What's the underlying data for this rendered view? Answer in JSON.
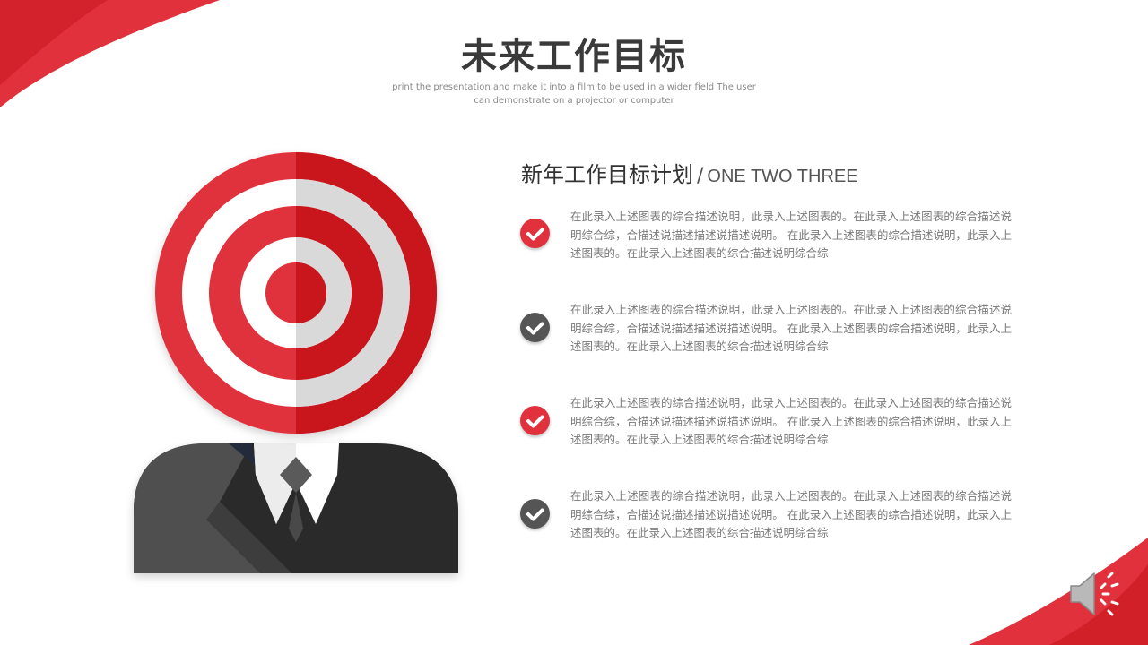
{
  "title": "未来工作目标",
  "subtitle": "print the presentation and make it into a film to be used in a wider field The user can demonstrate on a projector or computer",
  "section": {
    "heading_cn": "新年工作目标计划",
    "separator": "/",
    "heading_en": "ONE TWO THREE"
  },
  "items": [
    {
      "check_color": "#e0313d",
      "icon": "check-icon",
      "text": "在此录入上述图表的综合描述说明，此录入上述图表的。在此录入上述图表的综合描述说明综合综，合描述说描述描述说描述说明。 在此录入上述图表的综合描述说明，此录入上述图表的。在此录入上述图表的综合描述说明综合综"
    },
    {
      "check_color": "#555555",
      "icon": "check-icon",
      "text": "在此录入上述图表的综合描述说明，此录入上述图表的。在此录入上述图表的综合描述说明综合综，合描述说描述描述说描述说明。 在此录入上述图表的综合描述说明，此录入上述图表的。在此录入上述图表的综合描述说明综合综"
    },
    {
      "check_color": "#e0313d",
      "icon": "check-icon",
      "text": "在此录入上述图表的综合描述说明，此录入上述图表的。在此录入上述图表的综合描述说明综合综，合描述说描述描述说描述说明。 在此录入上述图表的综合描述说明，此录入上述图表的。在此录入上述图表的综合描述说明综合综"
    },
    {
      "check_color": "#555555",
      "icon": "check-icon",
      "text": "在此录入上述图表的综合描述说明，此录入上述图表的。在此录入上述图表的综合描述说明综合综，合描述说描述描述说描述说明。 在此录入上述图表的综合描述说明，此录入上述图表的。在此录入上述图表的综合描述说明综合综"
    }
  ],
  "colors": {
    "accent": "#e0313d",
    "dark_red": "#c8161d",
    "gray_dark": "#555555",
    "suit_dark": "#2c2c2c",
    "suit_light": "#4a4a4a"
  },
  "icons": {
    "target": "target-head-icon",
    "speaker": "speaker-icon"
  }
}
